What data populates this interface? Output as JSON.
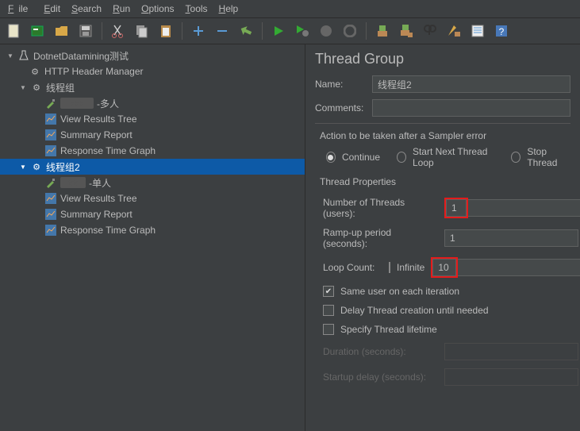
{
  "menu": {
    "file": "File",
    "edit": "Edit",
    "search": "Search",
    "run": "Run",
    "options": "Options",
    "tools": "Tools",
    "help": "Help"
  },
  "tree": {
    "test_plan": "DotnetDatamining测试",
    "header_mgr": "HTTP Header Manager",
    "tg1": "线程组",
    "tg1_sampler": "-多人",
    "view_results": "View Results Tree",
    "summary": "Summary Report",
    "resp_graph": "Response Time Graph",
    "tg2": "线程组2",
    "tg2_sampler": "-单人"
  },
  "panel": {
    "title": "Thread Group",
    "name_label": "Name:",
    "name_value": "线程组2",
    "comments_label": "Comments:",
    "comments_value": "",
    "action_legend": "Action to be taken after a Sampler error",
    "continue": "Continue",
    "start_next": "Start Next Thread Loop",
    "stop_thread": "Stop Thread",
    "props_legend": "Thread Properties",
    "num_threads_label": "Number of Threads (users):",
    "num_threads_value": "1",
    "rampup_label": "Ramp-up period (seconds):",
    "rampup_value": "1",
    "loop_label": "Loop Count:",
    "infinite_label": "Infinite",
    "loop_value": "10",
    "same_user": "Same user on each iteration",
    "delay_create": "Delay Thread creation until needed",
    "specify_lifetime": "Specify Thread lifetime",
    "duration_label": "Duration (seconds):",
    "startup_delay_label": "Startup delay (seconds):"
  }
}
